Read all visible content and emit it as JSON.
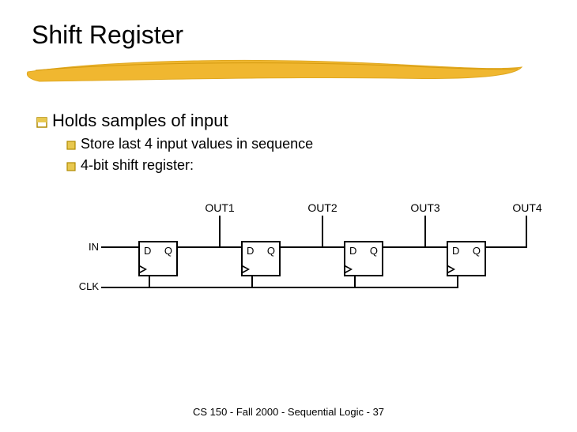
{
  "title": "Shift Register",
  "bullets": {
    "main": "Holds samples of input",
    "sub1": "Store last 4 input values in sequence",
    "sub2": "4-bit shift register:"
  },
  "diagram": {
    "outputs": [
      "OUT1",
      "OUT2",
      "OUT3",
      "OUT4"
    ],
    "in_label": "IN",
    "clk_label": "CLK",
    "ff_d": "D",
    "ff_q": "Q"
  },
  "footer": "CS 150 - Fall  2000 - Sequential Logic - 37"
}
